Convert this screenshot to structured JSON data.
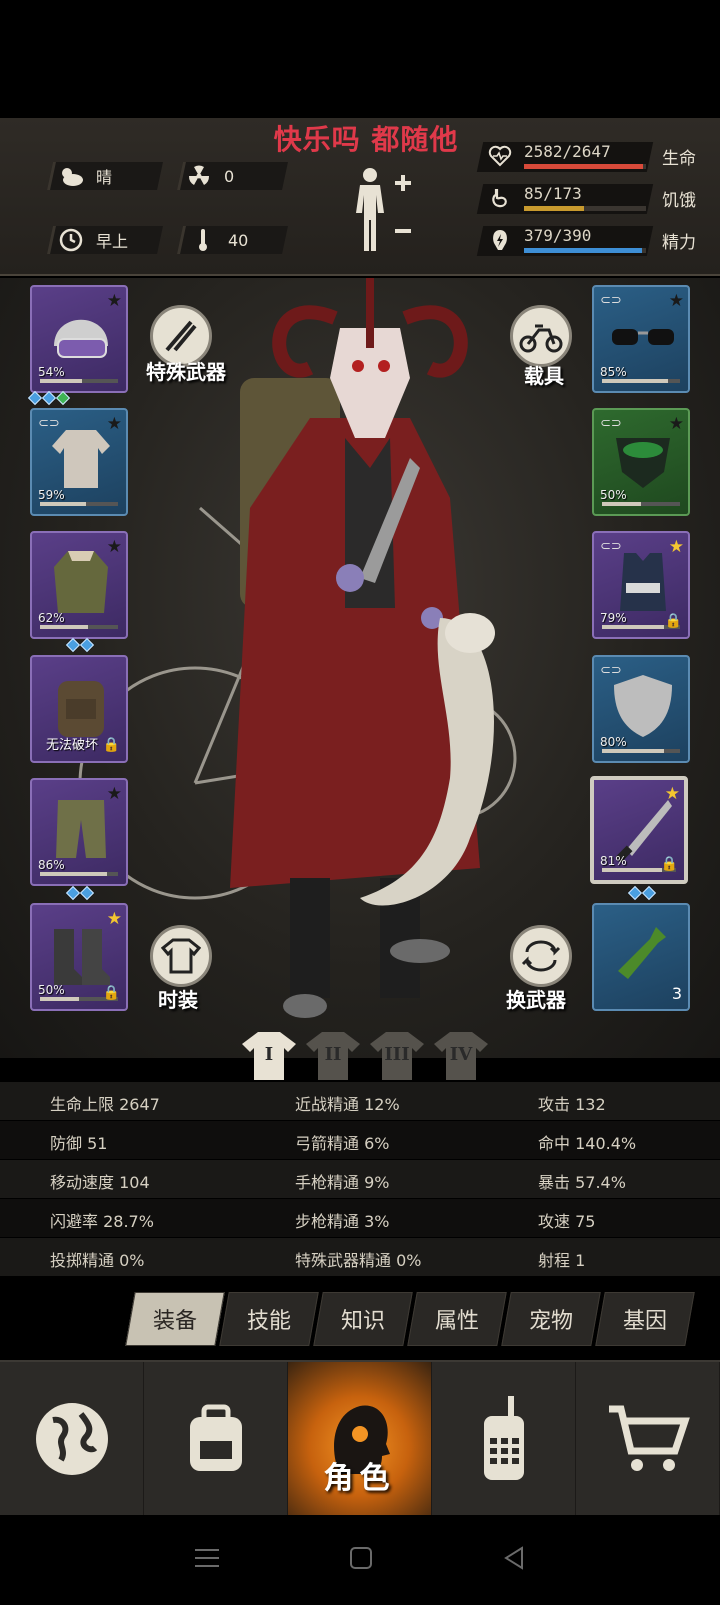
{
  "title": "快乐吗 都随他",
  "env": {
    "weather": "晴",
    "radiation": "0",
    "time_of_day": "早上",
    "temperature": "40"
  },
  "vitals": [
    {
      "label": "生命",
      "value": "2582/2647",
      "fraction": 0.975,
      "color": "#d84a3a",
      "icon": "heart-icon"
    },
    {
      "label": "饥饿",
      "value": "85/173",
      "fraction": 0.49,
      "color": "#c89a2e",
      "icon": "stomach-icon"
    },
    {
      "label": "精力",
      "value": "379/390",
      "fraction": 0.97,
      "color": "#3e8fd6",
      "icon": "energy-icon"
    }
  ],
  "buttons": {
    "special_weapon": "特殊武器",
    "vehicle": "载具",
    "fashion": "时装",
    "swap_weapon": "换武器"
  },
  "left_slots": [
    {
      "name": "helmet",
      "pct": "54%",
      "durability": 0.54
    },
    {
      "name": "shirt",
      "pct": "59%",
      "durability": 0.59
    },
    {
      "name": "coat",
      "pct": "62%",
      "durability": 0.62
    },
    {
      "name": "backpack",
      "note": "无法破坏"
    },
    {
      "name": "pants",
      "pct": "86%",
      "durability": 0.86
    },
    {
      "name": "boots",
      "pct": "50%",
      "durability": 0.5
    }
  ],
  "right_slots": [
    {
      "name": "sunglasses",
      "pct": "85%",
      "durability": 0.85
    },
    {
      "name": "gas-mask",
      "pct": "50%",
      "durability": 0.5
    },
    {
      "name": "police-vest",
      "pct": "79%",
      "durability": 0.79
    },
    {
      "name": "shield",
      "pct": "80%",
      "durability": 0.8
    },
    {
      "name": "machete",
      "pct": "81%",
      "durability": 0.81
    },
    {
      "name": "molotov",
      "count": "3"
    }
  ],
  "outfit_tabs": [
    "I",
    "II",
    "III",
    "IV"
  ],
  "stats": [
    [
      "生命上限 2647",
      "近战精通 12%",
      "攻击 132"
    ],
    [
      "防御 51",
      "弓箭精通 6%",
      "命中 140.4%"
    ],
    [
      "移动速度 104",
      "手枪精通 9%",
      "暴击 57.4%"
    ],
    [
      "闪避率 28.7%",
      "步枪精通 3%",
      "攻速 75"
    ],
    [
      "投掷精通 0%",
      "特殊武器精通 0%",
      "射程 1"
    ]
  ],
  "sub_tabs": [
    "装备",
    "技能",
    "知识",
    "属性",
    "宠物",
    "基因"
  ],
  "nav": {
    "active_label": "角色"
  }
}
